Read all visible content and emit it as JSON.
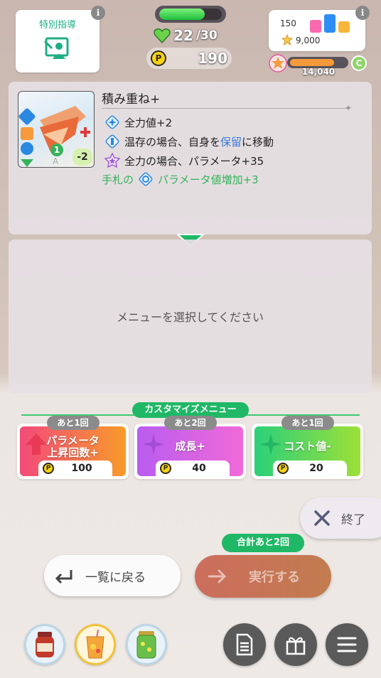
{
  "top": {
    "special_label": "特別指導",
    "stamina": {
      "current": "22",
      "max": "/30",
      "fraction": 0.73
    },
    "p_points": "190",
    "p_symbol": "P",
    "score_top": "150",
    "score_bottom": "9,000",
    "rank_value": "14,040",
    "rank_fraction": 0.8,
    "rank_badge": "C",
    "info_symbol": "i"
  },
  "card": {
    "title": "積み重ね+",
    "effects": [
      {
        "text": "全力値+2"
      },
      {
        "text_before": "温存の場合、自身を",
        "text_highlight": "保留",
        "text_after": "に移動"
      },
      {
        "text": "全力の場合、パラメータ+35"
      }
    ],
    "hand_effect_prefix": "手札の",
    "hand_effect_suffix": "パラメータ値増加+3",
    "thumb_level": "1",
    "thumb_cost": "-2",
    "thumb_rank": "A"
  },
  "menu": {
    "placeholder": "メニューを選択してください",
    "header": "カスタマイズメニュー"
  },
  "options": [
    {
      "remain": "あと1回",
      "title_line1": "パラメータ",
      "title_line2": "上昇回数+",
      "cost": "100",
      "color_from": "#f24a7a",
      "color_to": "#f79a2a"
    },
    {
      "remain": "あと2回",
      "title_line1": "成長+",
      "title_line2": "",
      "cost": "40",
      "color_from": "#b95cf0",
      "color_to": "#f06ad8"
    },
    {
      "remain": "あと1回",
      "title_line1": "コスト値-",
      "title_line2": "",
      "cost": "20",
      "color_from": "#2bd07a",
      "color_to": "#9de038"
    }
  ],
  "buttons": {
    "end": "終了",
    "total_remain": "合計あと2回",
    "back": "一覧に戻る",
    "execute": "実行する"
  },
  "bottom_icons": [
    "sauce-jar-icon",
    "juice-cup-icon",
    "pickle-jar-icon",
    "memo-icon",
    "gift-box-icon",
    "menu-icon"
  ]
}
